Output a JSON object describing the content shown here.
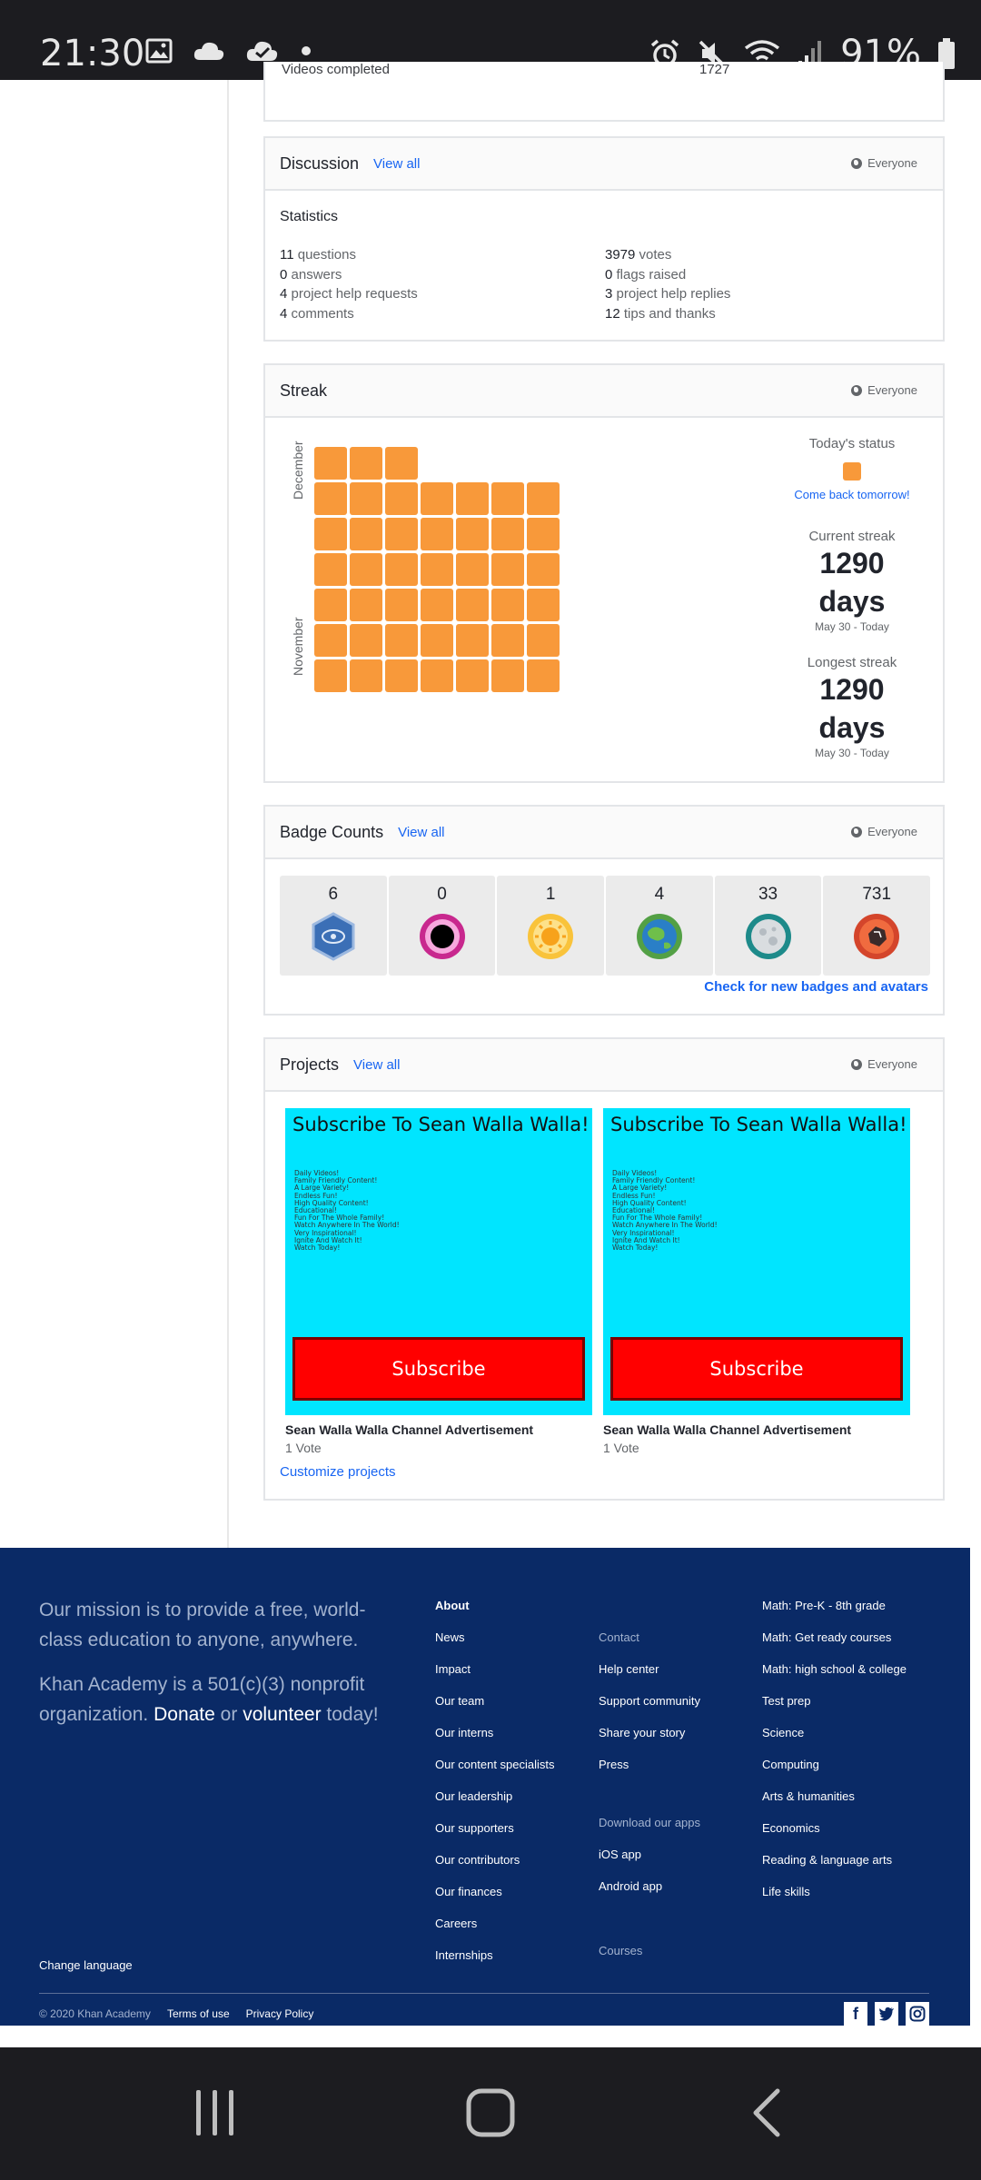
{
  "status_bar": {
    "time": "21:30",
    "battery": "91%",
    "icons": [
      "image-icon",
      "cloud-icon",
      "cloud-check-icon",
      "dot-icon",
      "alarm-icon",
      "mute-icon",
      "wifi-icon",
      "signal-icon",
      "battery-icon"
    ]
  },
  "top_card": {
    "left_text": "Videos completed",
    "right_text": "1727"
  },
  "discussion": {
    "title": "Discussion",
    "view_all": "View all",
    "visibility": "Everyone",
    "stats_title": "Statistics",
    "left": [
      {
        "num": "11",
        "label": "questions"
      },
      {
        "num": "0",
        "label": "answers"
      },
      {
        "num": "4",
        "label": "project help requests"
      },
      {
        "num": "4",
        "label": "comments"
      }
    ],
    "right": [
      {
        "num": "3979",
        "label": "votes"
      },
      {
        "num": "0",
        "label": "flags raised"
      },
      {
        "num": "3",
        "label": "project help replies"
      },
      {
        "num": "12",
        "label": "tips and thanks"
      }
    ]
  },
  "streak": {
    "title": "Streak",
    "visibility": "Everyone",
    "month_top": "December",
    "month_bottom": "November",
    "todays_status_label": "Today's status",
    "come_back": "Come back tomorrow!",
    "current_label": "Current streak",
    "current_value": "1290",
    "current_unit": "days",
    "current_range": "May 30 - Today",
    "longest_label": "Longest streak",
    "longest_value": "1290",
    "longest_unit": "days",
    "longest_range": "May 30 - Today",
    "color": "#f8993a"
  },
  "badges": {
    "title": "Badge Counts",
    "view_all": "View all",
    "visibility": "Everyone",
    "items": [
      {
        "count": "6",
        "icon": "challenge-patch-icon"
      },
      {
        "count": "0",
        "icon": "black-hole-badge-icon"
      },
      {
        "count": "1",
        "icon": "sun-badge-icon"
      },
      {
        "count": "4",
        "icon": "earth-badge-icon"
      },
      {
        "count": "33",
        "icon": "moon-badge-icon"
      },
      {
        "count": "731",
        "icon": "meteorite-badge-icon"
      }
    ],
    "check_link": "Check for new badges and avatars"
  },
  "projects": {
    "title": "Projects",
    "view_all": "View all",
    "visibility": "Everyone",
    "items": [
      {
        "thumb_heading": "Subscribe To Sean Walla Walla!",
        "thumb_lines": [
          "Daily Videos!",
          "Family Friendly Content!",
          "A Large Variety!",
          "Endless Fun!",
          "High Quality Content!",
          "Educational!",
          "Fun For The Whole Family!",
          "Watch Anywhere In The World!",
          "Very Inspirational!",
          "Ignite And Watch It!",
          "Watch Today!"
        ],
        "thumb_button": "Subscribe",
        "title": "Sean Walla Walla Channel Advertisement",
        "votes": "1 Vote"
      },
      {
        "thumb_heading": "Subscribe To Sean Walla Walla!",
        "thumb_lines": [
          "Daily Videos!",
          "Family Friendly Content!",
          "A Large Variety!",
          "Endless Fun!",
          "High Quality Content!",
          "Educational!",
          "Fun For The Whole Family!",
          "Watch Anywhere In The World!",
          "Very Inspirational!",
          "Ignite And Watch It!",
          "Watch Today!"
        ],
        "thumb_button": "Subscribe",
        "title": "Sean Walla Walla Channel Advertisement",
        "votes": "1 Vote"
      }
    ],
    "customize": "Customize projects"
  },
  "footer": {
    "mission": "Our mission is to provide a free, world-class education to anyone, anywhere.",
    "nonprofit_pre": "Khan Academy is a 501(c)(3) nonprofit organization.",
    "donate": "Donate",
    "or": "or",
    "volunteer": "volunteer",
    "today": "today!",
    "about": {
      "head": "About",
      "items": [
        "News",
        "Impact",
        "Our team",
        "Our interns",
        "Our content specialists",
        "Our leadership",
        "Our supporters",
        "Our contributors",
        "Our finances",
        "Careers",
        "Internships"
      ]
    },
    "contact": {
      "head": "Contact",
      "items": [
        "Help center",
        "Support community",
        "Share your story",
        "Press"
      ]
    },
    "apps": {
      "head": "Download our apps",
      "items": [
        "iOS app",
        "Android app"
      ]
    },
    "courses_head": "Courses",
    "courses": [
      "Math: Pre-K - 8th grade",
      "Math: Get ready courses",
      "Math: high school & college",
      "Test prep",
      "Science",
      "Computing",
      "Arts & humanities",
      "Economics",
      "Reading & language arts",
      "Life skills"
    ],
    "change_language": "Change language",
    "copyright": "© 2020 Khan Academy",
    "terms": "Terms of use",
    "privacy": "Privacy Policy",
    "social": [
      "facebook-icon",
      "twitter-icon",
      "instagram-icon"
    ],
    "bg_color": "#0a2a66"
  },
  "nav_bar": {
    "buttons": [
      "recent-apps-icon",
      "home-icon",
      "back-icon"
    ]
  }
}
